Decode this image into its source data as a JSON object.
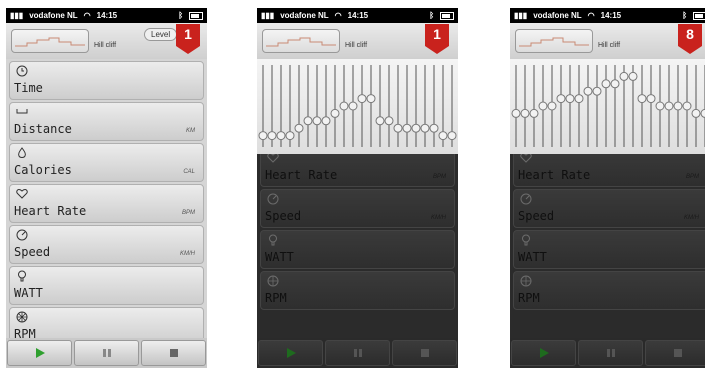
{
  "status": {
    "carrier": "vodafone NL",
    "time": "14:15"
  },
  "profile": {
    "name": "Hill cliff"
  },
  "level_label": "Level",
  "screens": [
    {
      "level": "1"
    },
    {
      "level": "1"
    },
    {
      "level": "8"
    }
  ],
  "metrics": [
    {
      "label": "Time",
      "unit": "",
      "icon": "clock-icon"
    },
    {
      "label": "Distance",
      "unit": "KM",
      "icon": "distance-icon"
    },
    {
      "label": "Calories",
      "unit": "CAL",
      "icon": "flame-icon"
    },
    {
      "label": "Heart Rate",
      "unit": "BPM",
      "icon": "heart-icon"
    },
    {
      "label": "Speed",
      "unit": "KM/H",
      "icon": "speedometer-icon"
    },
    {
      "label": "WATT",
      "unit": "",
      "icon": "bulb-icon"
    },
    {
      "label": "RPM",
      "unit": "",
      "icon": "gear-icon"
    }
  ],
  "controls": {
    "play_icon": "play-icon",
    "pause_icon": "pause-icon",
    "stop_icon": "stop-icon"
  },
  "level_profile": {
    "screen2_levels": [
      1,
      1,
      1,
      1,
      2,
      3,
      3,
      3,
      4,
      5,
      5,
      6,
      6,
      3,
      3,
      2,
      2,
      2,
      2,
      2,
      1,
      1
    ],
    "screen3_levels": [
      4,
      4,
      4,
      5,
      5,
      6,
      6,
      6,
      7,
      7,
      8,
      8,
      9,
      9,
      6,
      6,
      5,
      5,
      5,
      5,
      4,
      4
    ]
  },
  "colors": {
    "accent_red": "#c9221d",
    "bar_bg": "#d5d5d5"
  }
}
